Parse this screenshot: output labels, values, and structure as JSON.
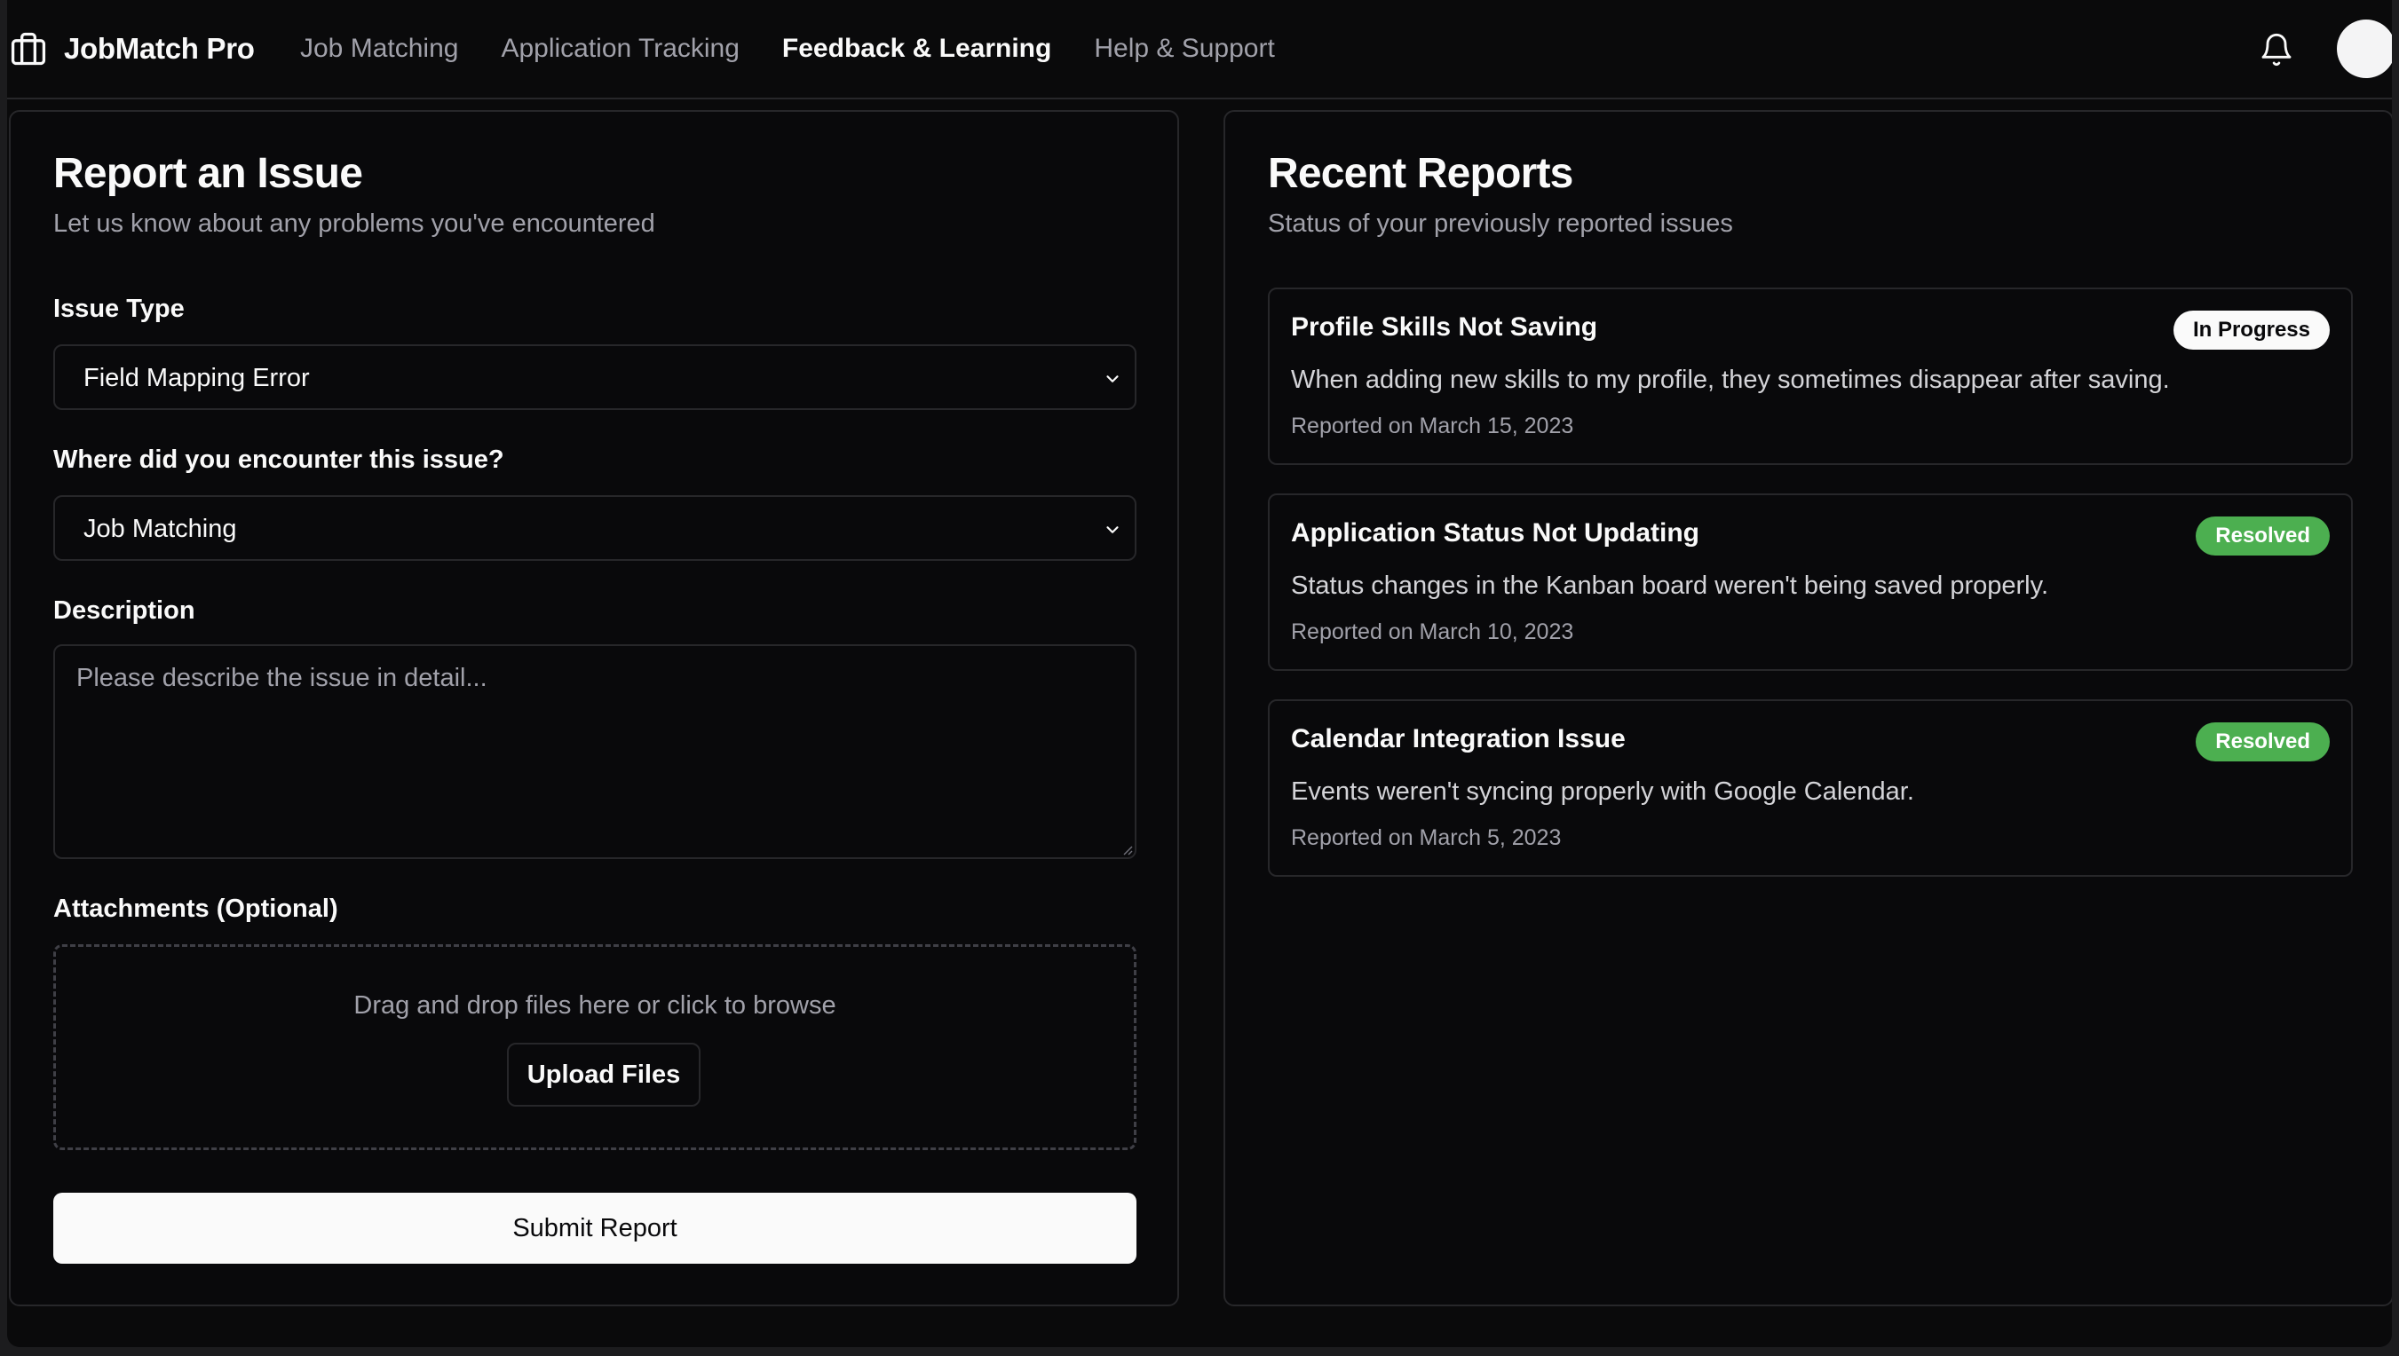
{
  "app": {
    "name": "JobMatch Pro"
  },
  "nav": {
    "links": [
      {
        "label": "Job Matching",
        "active": false
      },
      {
        "label": "Application Tracking",
        "active": false
      },
      {
        "label": "Feedback & Learning",
        "active": true
      },
      {
        "label": "Help & Support",
        "active": false
      }
    ],
    "icons": {
      "brand": "briefcase-icon",
      "notifications": "bell-icon",
      "avatar": "user-avatar"
    }
  },
  "report_form": {
    "title": "Report an Issue",
    "subtitle": "Let us know about any problems you've encountered",
    "issue_type": {
      "label": "Issue Type",
      "value": "Field Mapping Error"
    },
    "location": {
      "label": "Where did you encounter this issue?",
      "value": "Job Matching"
    },
    "description": {
      "label": "Description",
      "placeholder": "Please describe the issue in detail...",
      "value": ""
    },
    "attachments": {
      "label": "Attachments (Optional)",
      "drop_text": "Drag and drop files here or click to browse",
      "upload_label": "Upload Files"
    },
    "submit_label": "Submit Report"
  },
  "recent_reports": {
    "title": "Recent Reports",
    "subtitle": "Status of your previously reported issues",
    "items": [
      {
        "title": "Profile Skills Not Saving",
        "status": "In Progress",
        "description": "When adding new skills to my profile, they sometimes disappear after saving.",
        "date": "Reported on March 15, 2023"
      },
      {
        "title": "Application Status Not Updating",
        "status": "Resolved",
        "description": "Status changes in the Kanban board weren't being saved properly.",
        "date": "Reported on March 10, 2023"
      },
      {
        "title": "Calendar Integration Issue",
        "status": "Resolved",
        "description": "Events weren't syncing properly with Google Calendar.",
        "date": "Reported on March 5, 2023"
      }
    ]
  },
  "colors": {
    "background": "#0a0a0b",
    "border": "#27272a",
    "text": "#fafafa",
    "muted": "#a1a1aa",
    "resolved": "#4caf50",
    "in_progress": "#fafafa"
  }
}
